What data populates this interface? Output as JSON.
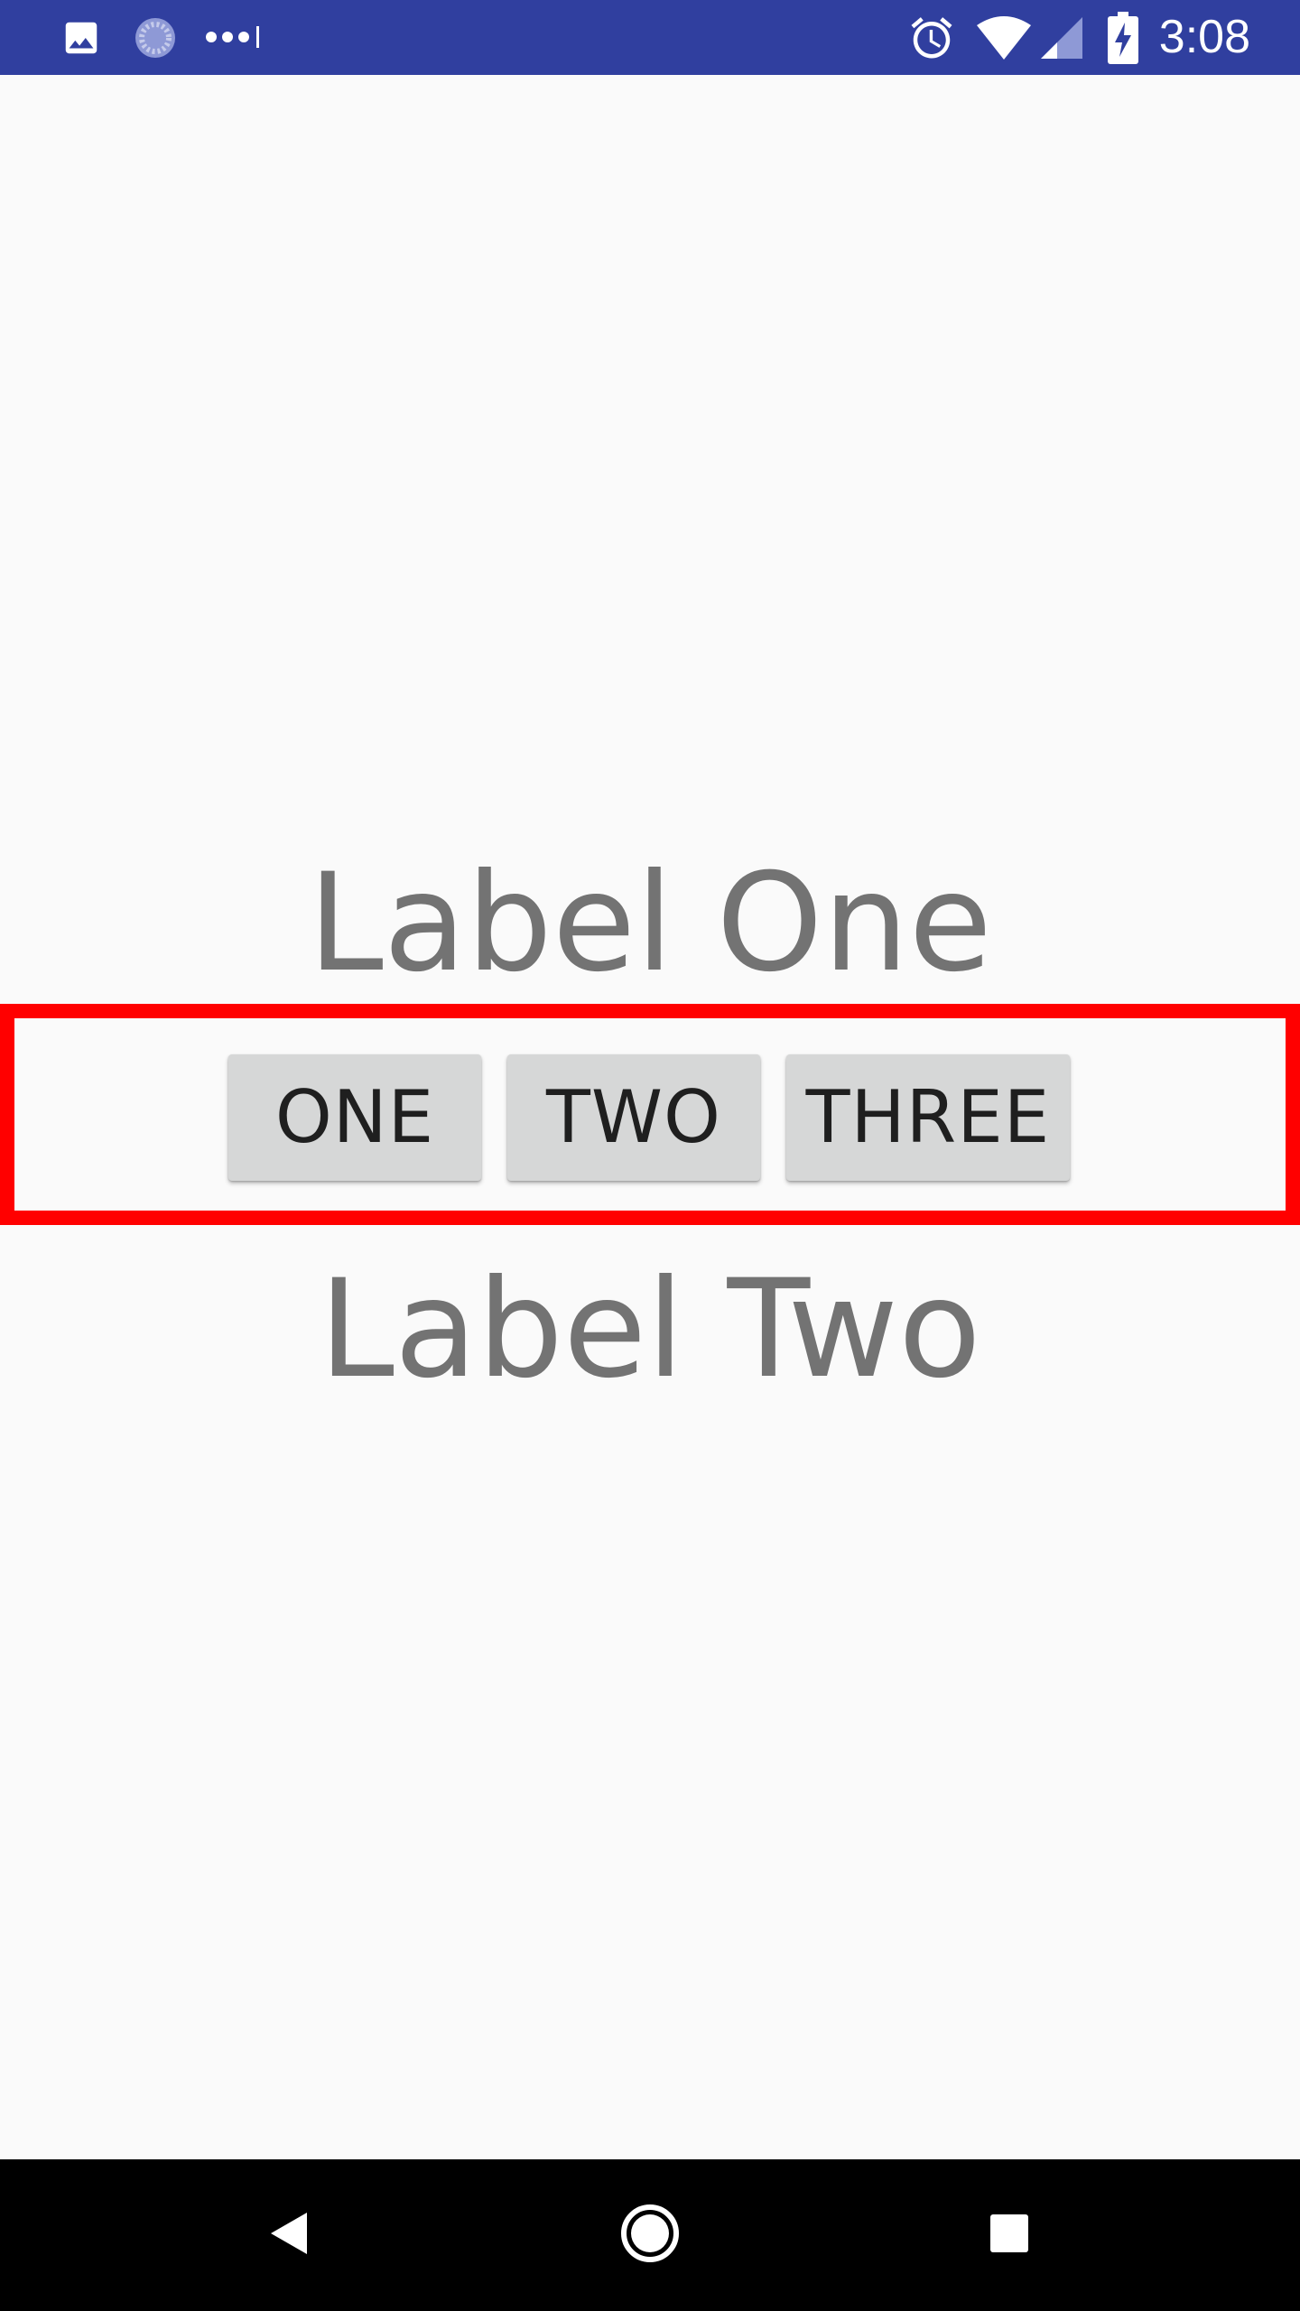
{
  "status_bar": {
    "time": "3:08",
    "icons": [
      "image-icon",
      "sync-icon",
      "more-dots-icon",
      "alarm-icon",
      "wifi-icon",
      "cell-signal-icon",
      "battery-charging-icon"
    ],
    "background_color": "#303f9f"
  },
  "content": {
    "label_one": "Label One",
    "label_two": "Label Two",
    "buttons": [
      {
        "label": "ONE"
      },
      {
        "label": "TWO"
      },
      {
        "label": "THREE"
      }
    ],
    "highlight_color": "#ff0000"
  },
  "nav_bar": {
    "icons": [
      "back-icon",
      "home-icon",
      "recents-icon"
    ]
  }
}
